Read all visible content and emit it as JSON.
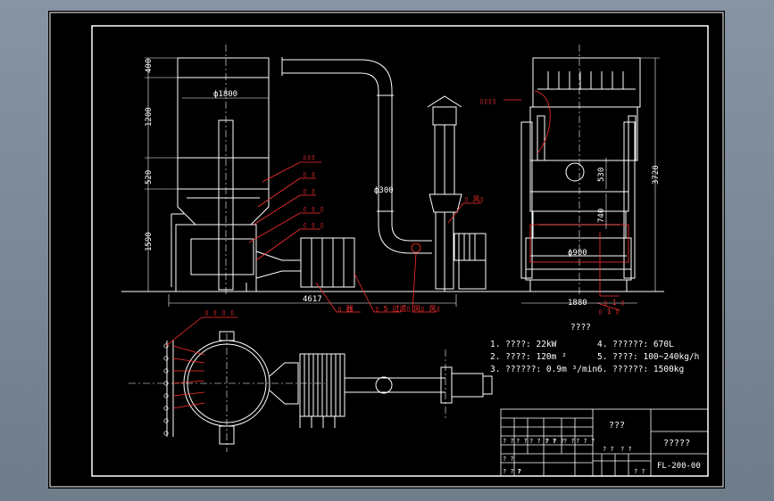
{
  "drawing": {
    "dims": {
      "h400": "400",
      "h1200": "1200",
      "h520": "520",
      "h1590": "1590",
      "dia1800": "ф1800",
      "dia300": "ф300",
      "dia900": "ф900",
      "w4617": "4617",
      "w1880": "1880",
      "h3720": "3720",
      "h530": "530",
      "h740": "740"
    },
    "callouts": {
      "c1": "▯▯▯",
      "c2": "▯ ▯",
      "c3": "▯ ▯",
      "c4": "▯ ▯ ▯",
      "c5": "▯ ▯ ▯",
      "c6": "▯ 风▯",
      "c7": "▯ 器",
      "c8": "▯ 5 过滤▯",
      "c9": "风▯ 风▯",
      "c10": "▯▯▯▯",
      "c11": "▯ 1 ▯",
      "c12": "▯ 1 ▯",
      "c13": "▯ ▯ ▯ ▯"
    },
    "specs": {
      "title": "????",
      "items": [
        "1. ????: 22kW",
        "2. ????: 120m ²",
        "3. ??????: 0.9m ³/min",
        "4. ??????: 670L",
        "5. ????: 100~240kg/h",
        "6. ??????: 1500kg"
      ]
    },
    "title_block": {
      "name": "???",
      "company": "?????",
      "code": "FL-200-00",
      "cells": [
        "? ?",
        "? ?",
        "? ? ? ?",
        "? ? ?",
        "? ?",
        "? ? ?",
        "? ?",
        "? ? ?",
        "?",
        "? ?",
        "? ?",
        "? ?"
      ]
    }
  }
}
